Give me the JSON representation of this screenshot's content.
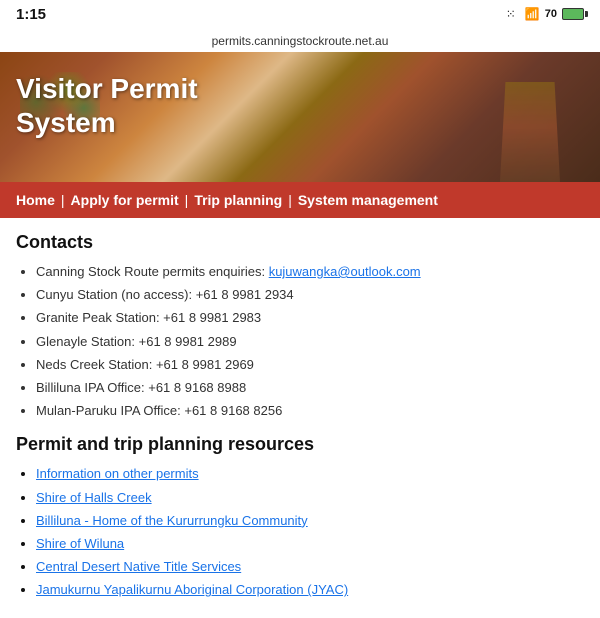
{
  "statusBar": {
    "time": "1:15",
    "signal": "..!",
    "wifi": "wifi",
    "battery": "70"
  },
  "urlBar": {
    "url": "permits.canningstockroute.net.au"
  },
  "hero": {
    "title_line1": "Visitor Permit",
    "title_line2": "System"
  },
  "nav": {
    "home": "Home",
    "sep1": "|",
    "applyForPermit": "Apply for permit",
    "sep2": "|",
    "tripPlanning": "Trip planning",
    "sep3": "|",
    "systemManagement": "System management"
  },
  "contacts": {
    "heading": "Contacts",
    "items": [
      {
        "text": "Canning Stock Route permits enquiries: ",
        "link": "kujuwangka@outlook.com",
        "href": "mailto:kujuwangka@outlook.com"
      },
      {
        "text": "Cunyu Station (no access): +61 8 9981 2934"
      },
      {
        "text": "Granite Peak Station: +61 8 9981 2983"
      },
      {
        "text": "Glenayle Station: +61 8 9981 2989"
      },
      {
        "text": "Neds Creek Station: +61 8 9981 2969"
      },
      {
        "text": "Billiluna IPA Office: +61 8 9168 8988"
      },
      {
        "text": "Mulan-Paruku IPA Office: +61 8 9168 8256"
      }
    ]
  },
  "resources": {
    "heading": "Permit and trip planning resources",
    "items": [
      {
        "label": "Information on other permits",
        "href": "#"
      },
      {
        "label": "Shire of Halls Creek",
        "href": "#"
      },
      {
        "label": "Billiluna - Home of the Kururrungku Community",
        "href": "#"
      },
      {
        "label": "Shire of Wiluna",
        "href": "#"
      },
      {
        "label": "Central Desert Native Title Services",
        "href": "#"
      },
      {
        "label": "Jamukurnu Yapalikurnu Aboriginal Corporation (JYAC)",
        "href": "#"
      }
    ]
  }
}
